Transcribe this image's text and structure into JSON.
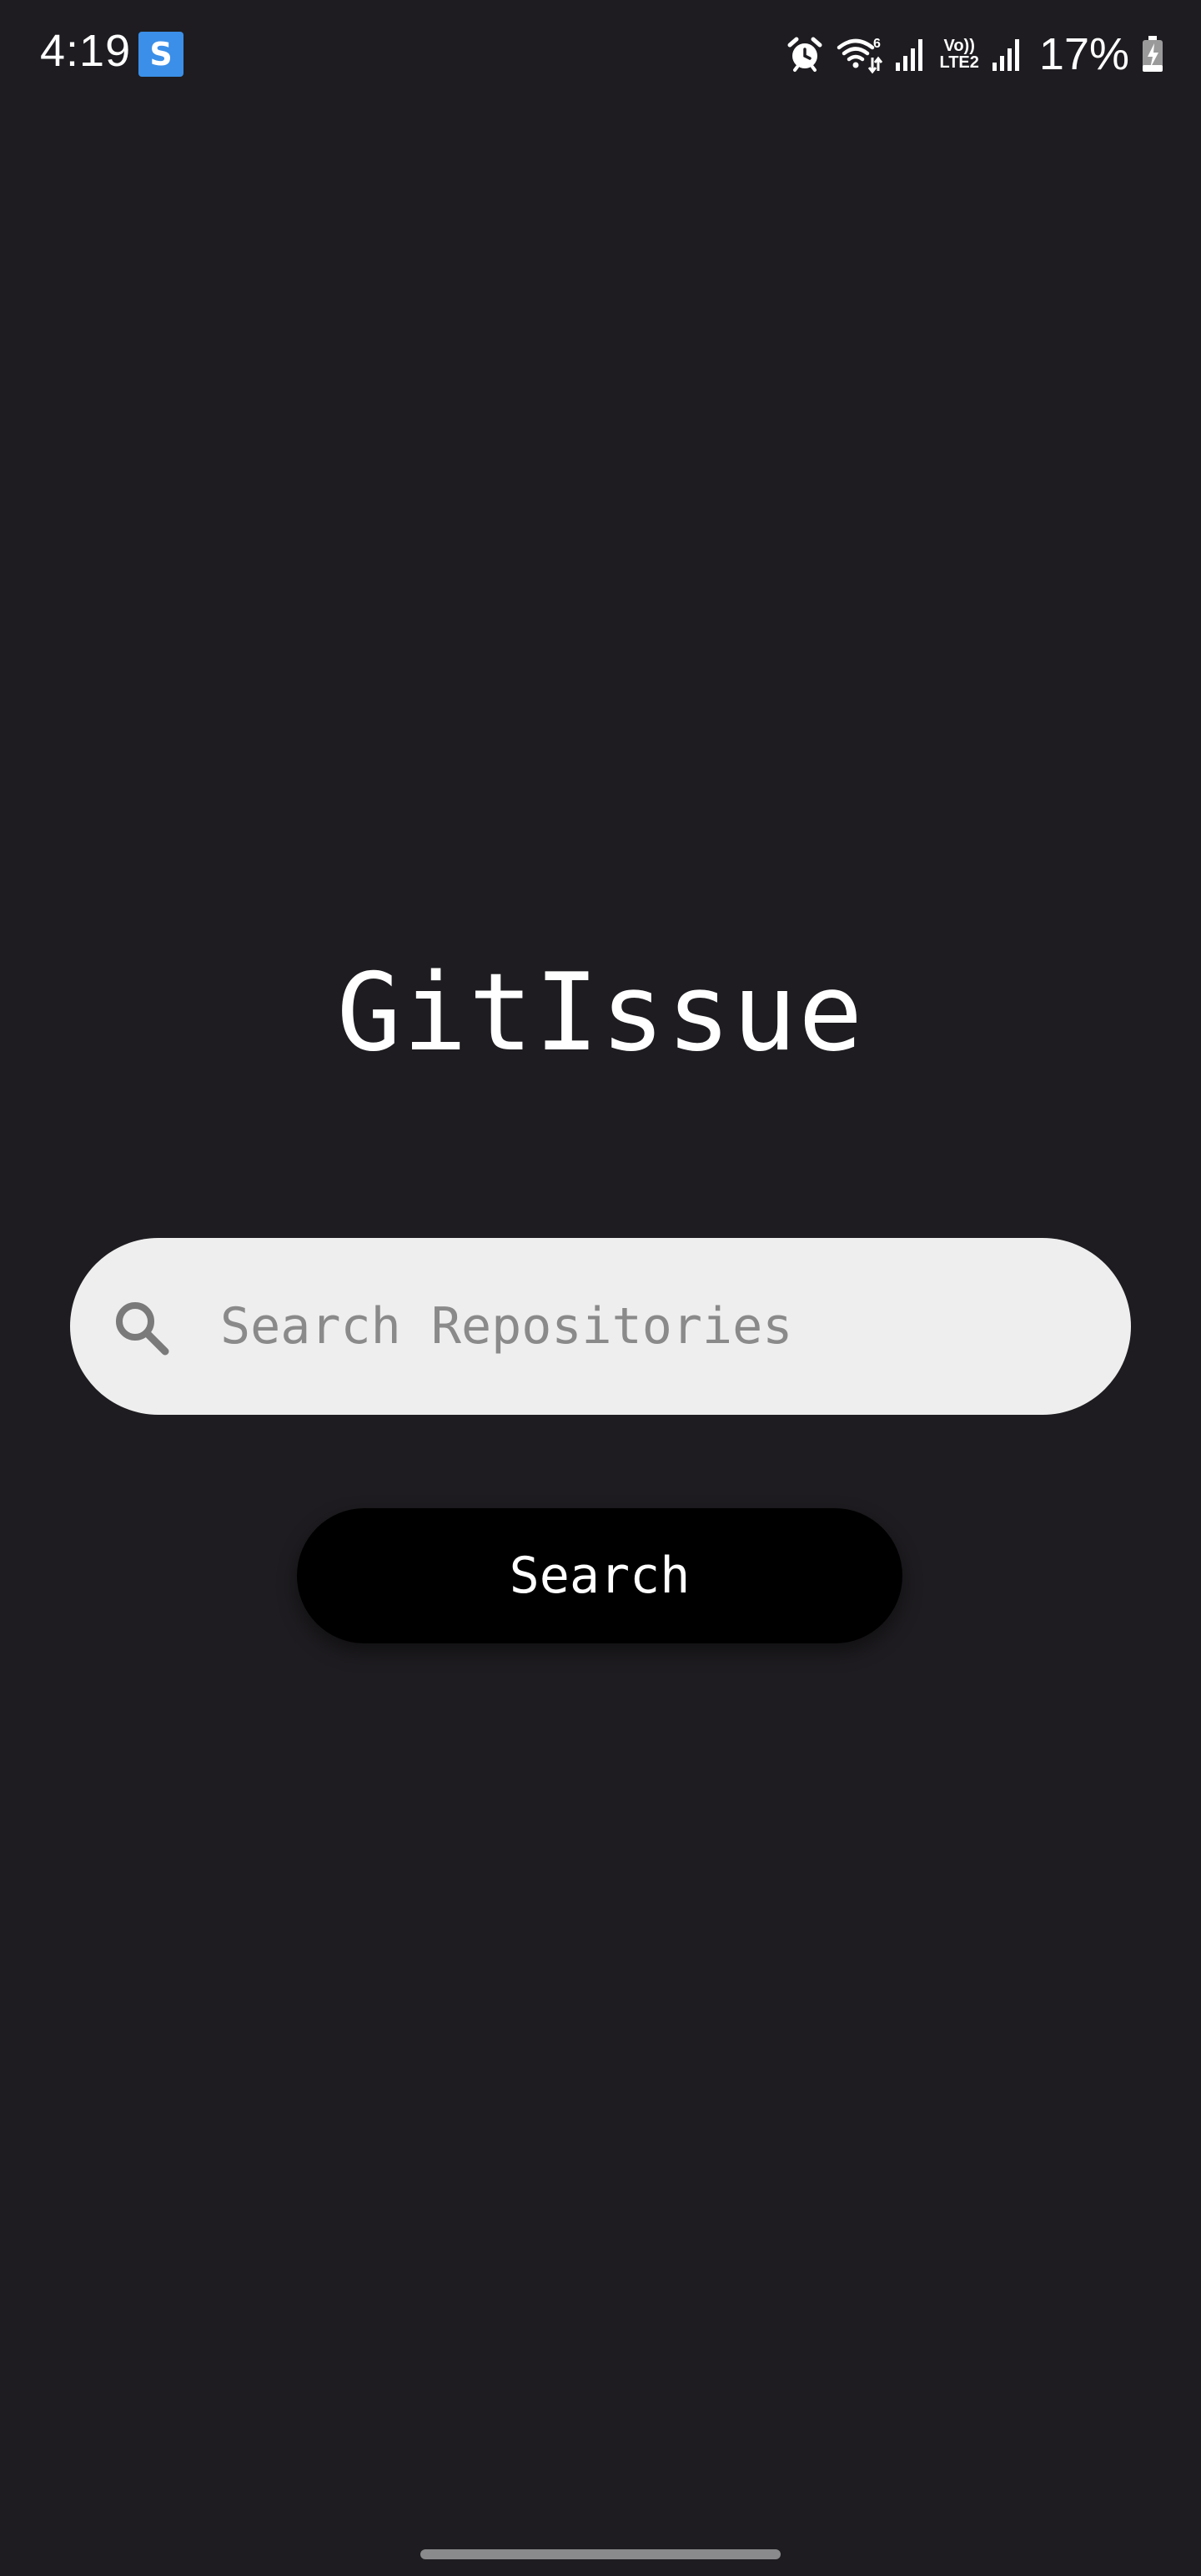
{
  "status_bar": {
    "time": "4:19",
    "notification_icon": "app-notification-icon",
    "icons": [
      "alarm-icon",
      "wifi-icon",
      "signal-icon",
      "volte-lte2-icon",
      "signal-icon",
      "battery-charging-icon"
    ],
    "lte_top": "Vo))",
    "lte_bottom": "LTE2",
    "battery": "17%"
  },
  "app": {
    "title": "GitIssue"
  },
  "search": {
    "placeholder": "Search Repositories",
    "value": "",
    "icon": "search-icon",
    "button_label": "Search"
  },
  "colors": {
    "background": "#1e1c20",
    "search_field": "#eeeeee",
    "button": "#000000",
    "notification_accent": "#3b8fe8"
  }
}
